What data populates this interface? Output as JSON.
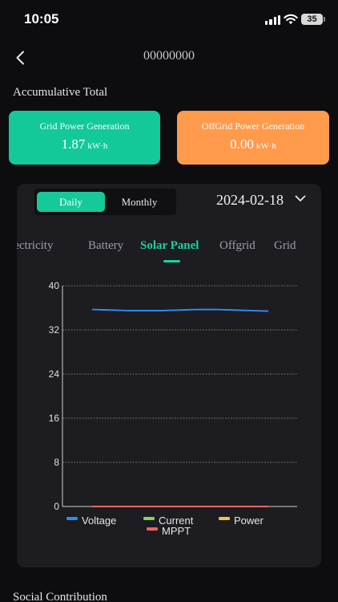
{
  "status_bar": {
    "time": "10:05",
    "battery": "35"
  },
  "header": {
    "title": "00000000"
  },
  "accumulative": {
    "title": "Accumulative Total",
    "grid": {
      "label": "Grid Power Generation",
      "value": "1.87",
      "unit": "kW·h",
      "color": "#13c99a"
    },
    "offgrid": {
      "label": "OffGrid Power Generation",
      "value": "0.00",
      "unit": "kW·h",
      "color": "#ff9a4d"
    }
  },
  "panel": {
    "toggle": {
      "daily": "Daily",
      "monthly": "Monthly",
      "selected": "Daily"
    },
    "date": "2024-02-18",
    "tabs": [
      "Electricity",
      "Battery",
      "Solar Panel",
      "Offgrid",
      "Grid"
    ],
    "active_tab": "Solar Panel",
    "accent": "#1fd1a1"
  },
  "chart_data": {
    "type": "line",
    "ylim": [
      0,
      40
    ],
    "yticks": [
      "0",
      "8",
      "16",
      "24",
      "32",
      "40"
    ],
    "x": [
      0,
      1,
      2,
      3,
      4,
      5,
      6,
      7,
      8,
      9,
      10
    ],
    "series": [
      {
        "name": "Voltage",
        "color": "#2f8cf0",
        "values": [
          35.7,
          35.6,
          35.5,
          35.5,
          35.5,
          35.6,
          35.7,
          35.7,
          35.6,
          35.5,
          35.4
        ]
      },
      {
        "name": "Current",
        "color": "#8ccf5a",
        "values": [
          0,
          0,
          0,
          0,
          0,
          0,
          0,
          0,
          0,
          0,
          0
        ]
      },
      {
        "name": "Power",
        "color": "#f5c04e",
        "values": [
          0,
          0,
          0,
          0,
          0,
          0,
          0,
          0,
          0,
          0,
          0
        ]
      },
      {
        "name": "MPPT",
        "color": "#f0655e",
        "values": [
          0,
          0,
          0,
          0,
          0,
          0,
          0,
          0,
          0,
          0,
          0
        ]
      }
    ],
    "grid": true,
    "legend": "bottom"
  },
  "social": {
    "title": "Social Contribution"
  }
}
